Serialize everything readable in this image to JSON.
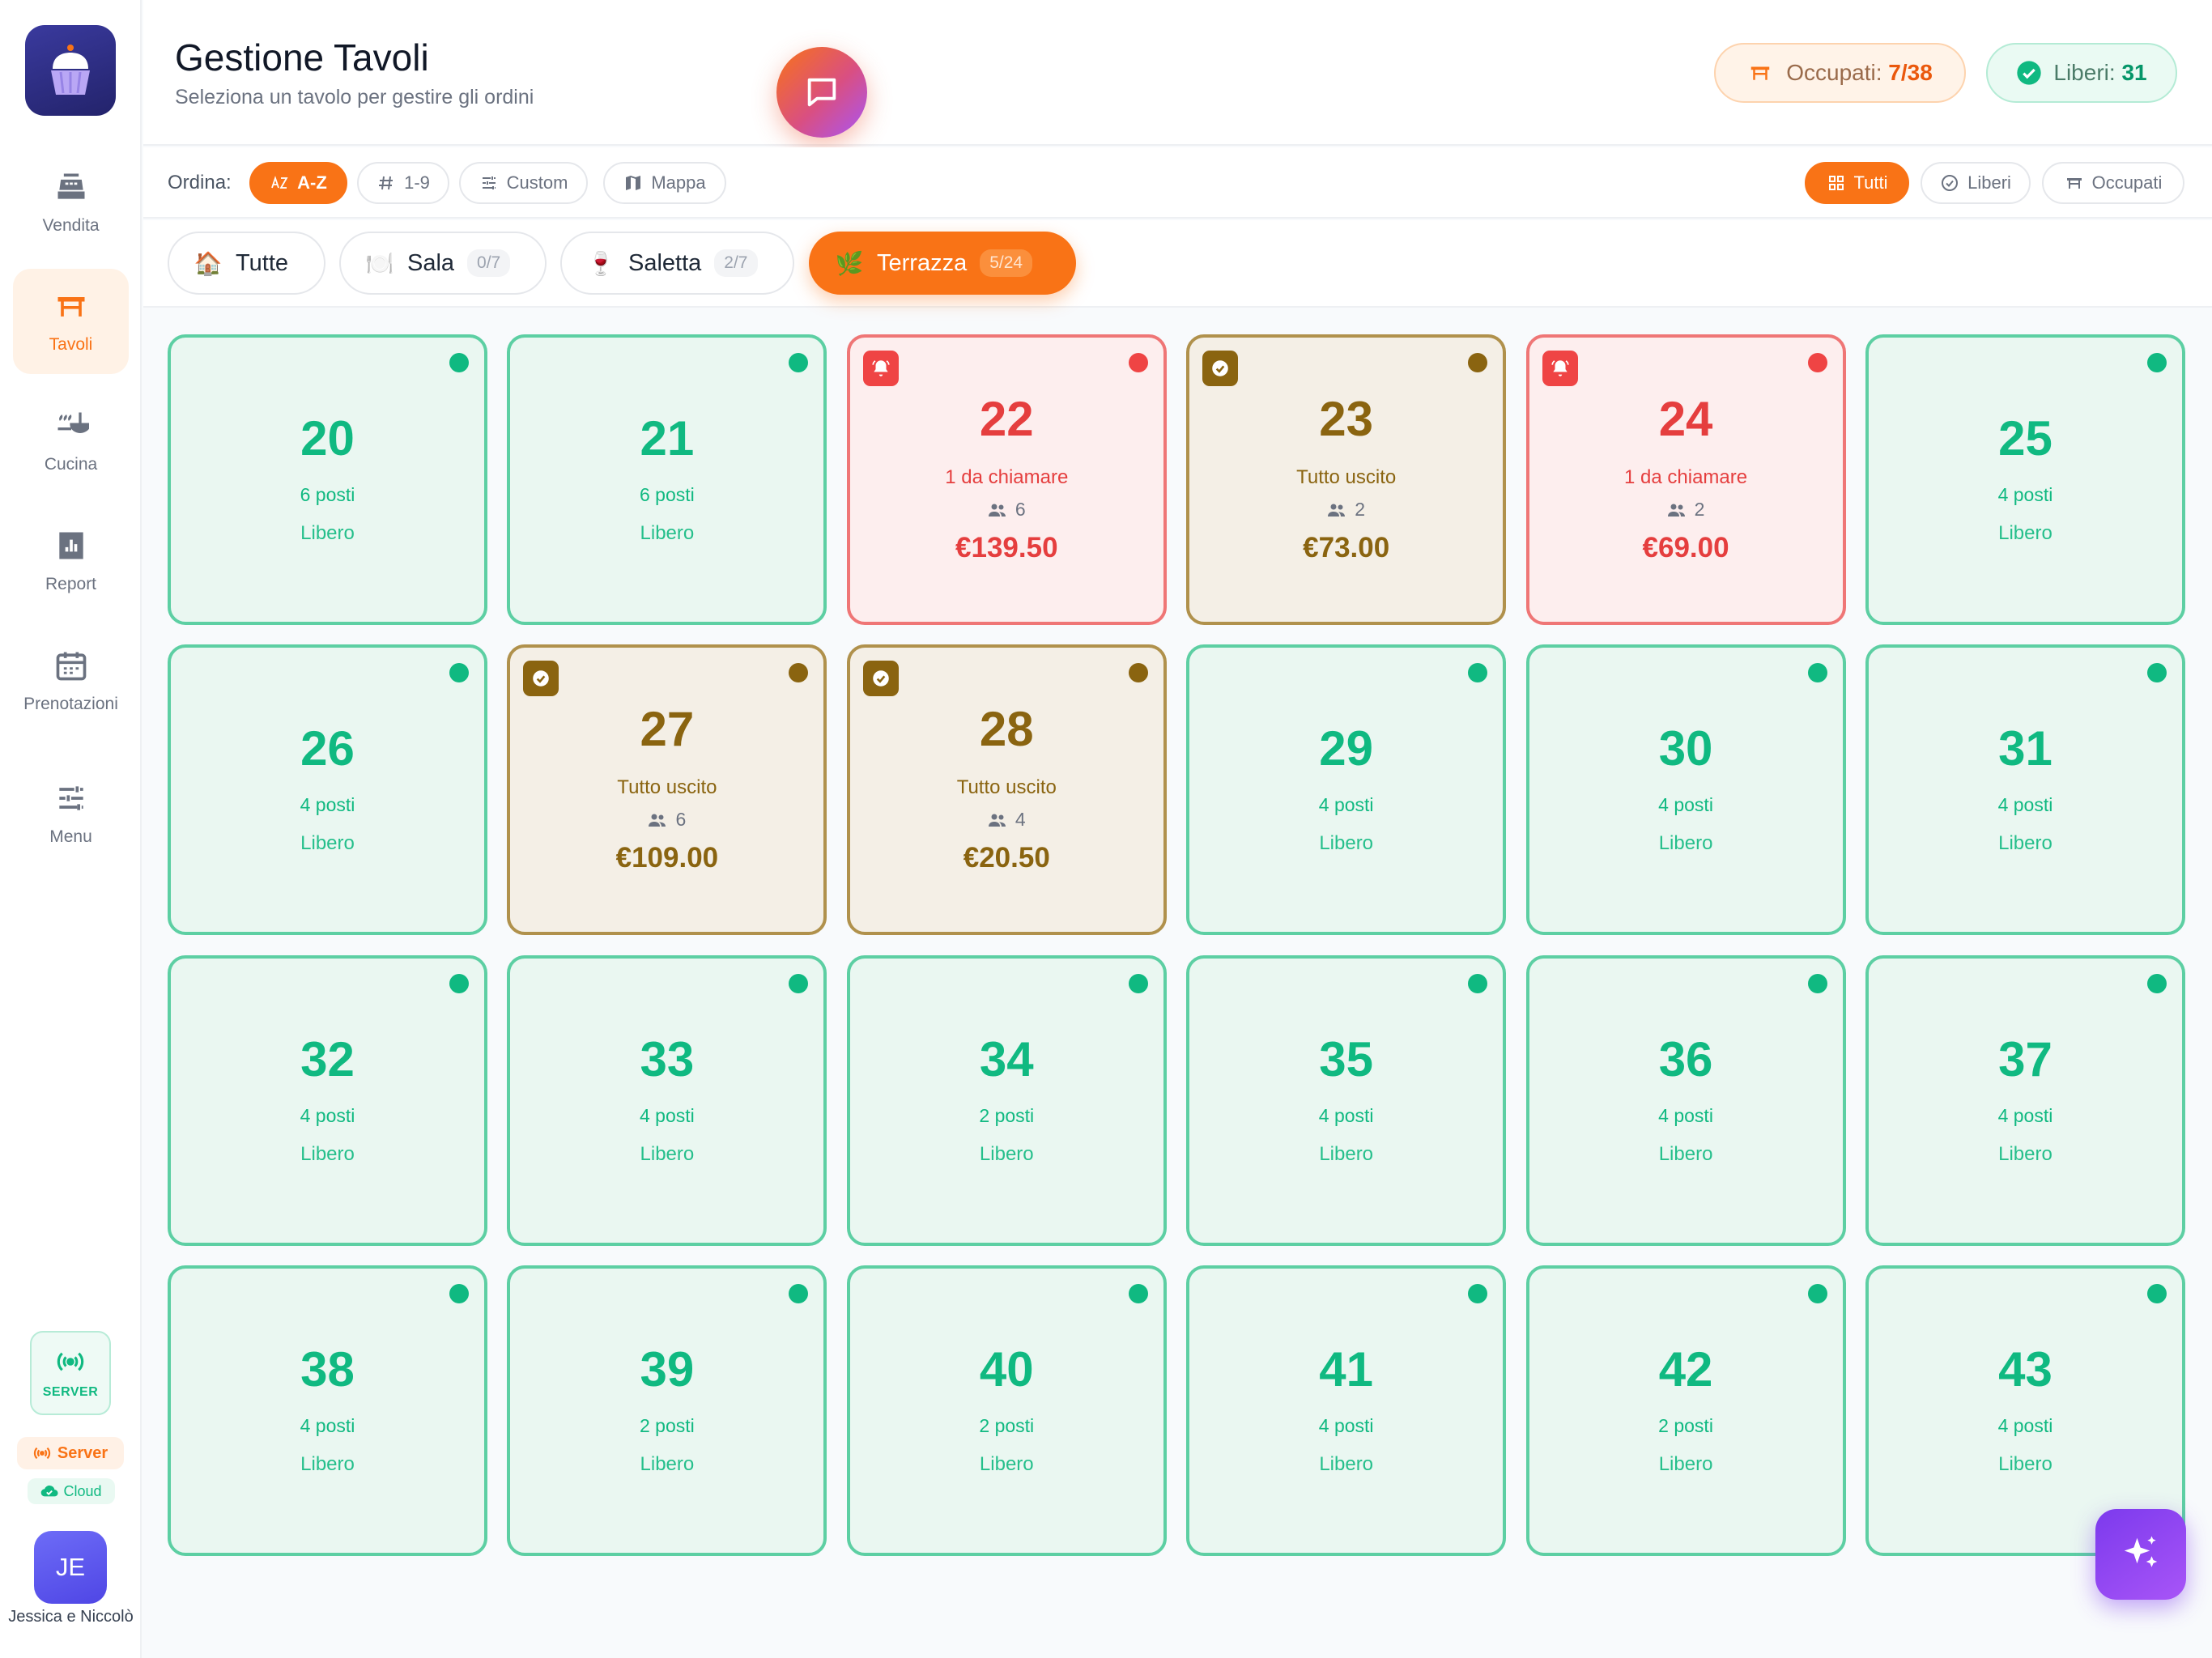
{
  "sidebar": {
    "items": [
      {
        "label": "Vendita",
        "icon": "cash-register-icon",
        "active": false
      },
      {
        "label": "Tavoli",
        "icon": "table-icon",
        "active": true
      },
      {
        "label": "Cucina",
        "icon": "ladle-icon",
        "active": false
      },
      {
        "label": "Report",
        "icon": "chart-icon",
        "active": false
      },
      {
        "label": "Prenotazioni",
        "icon": "calendar-icon",
        "active": false
      },
      {
        "label": "Menu",
        "icon": "sliders-icon",
        "active": false
      }
    ],
    "server_badge": "SERVER",
    "server_pill": "Server",
    "cloud_pill": "Cloud",
    "user_initials": "JE",
    "user_name": "Jessica e Niccolò"
  },
  "header": {
    "title": "Gestione Tavoli",
    "subtitle": "Seleziona un tavolo per gestire gli ordini",
    "occupied_label": "Occupati:",
    "occupied_value": "7/38",
    "free_label": "Liberi:",
    "free_value": "31"
  },
  "sort": {
    "label": "Ordina:",
    "options": [
      "A-Z",
      "1-9",
      "Custom",
      "Mappa"
    ],
    "active": "A-Z"
  },
  "filters": {
    "options": [
      "Tutti",
      "Liberi",
      "Occupati"
    ],
    "active": "Tutti"
  },
  "rooms": [
    {
      "emoji": "🏠",
      "name": "Tutte",
      "count": ""
    },
    {
      "emoji": "🍽️",
      "name": "Sala",
      "count": "0/7"
    },
    {
      "emoji": "🍷",
      "name": "Saletta",
      "count": "2/7"
    },
    {
      "emoji": "🌿",
      "name": "Terrazza",
      "count": "5/24"
    }
  ],
  "active_room": "Terrazza",
  "colors": {
    "accent": "#f97316",
    "free": "#10b981",
    "call": "#ef4444",
    "served": "#8a6410"
  },
  "tables": [
    {
      "number": "20",
      "status": "free",
      "seats": "6 posti",
      "state": "Libero"
    },
    {
      "number": "21",
      "status": "free",
      "seats": "6 posti",
      "state": "Libero"
    },
    {
      "number": "22",
      "status": "call",
      "info": "1 da chiamare",
      "guests": "6",
      "total": "€139.50"
    },
    {
      "number": "23",
      "status": "out",
      "info": "Tutto uscito",
      "guests": "2",
      "total": "€73.00"
    },
    {
      "number": "24",
      "status": "call",
      "info": "1 da chiamare",
      "guests": "2",
      "total": "€69.00"
    },
    {
      "number": "25",
      "status": "free",
      "seats": "4 posti",
      "state": "Libero"
    },
    {
      "number": "26",
      "status": "free",
      "seats": "4 posti",
      "state": "Libero"
    },
    {
      "number": "27",
      "status": "out",
      "info": "Tutto uscito",
      "guests": "6",
      "total": "€109.00"
    },
    {
      "number": "28",
      "status": "out",
      "info": "Tutto uscito",
      "guests": "4",
      "total": "€20.50"
    },
    {
      "number": "29",
      "status": "free",
      "seats": "4 posti",
      "state": "Libero"
    },
    {
      "number": "30",
      "status": "free",
      "seats": "4 posti",
      "state": "Libero"
    },
    {
      "number": "31",
      "status": "free",
      "seats": "4 posti",
      "state": "Libero"
    },
    {
      "number": "32",
      "status": "free",
      "seats": "4 posti",
      "state": "Libero"
    },
    {
      "number": "33",
      "status": "free",
      "seats": "4 posti",
      "state": "Libero"
    },
    {
      "number": "34",
      "status": "free",
      "seats": "2 posti",
      "state": "Libero"
    },
    {
      "number": "35",
      "status": "free",
      "seats": "4 posti",
      "state": "Libero"
    },
    {
      "number": "36",
      "status": "free",
      "seats": "4 posti",
      "state": "Libero"
    },
    {
      "number": "37",
      "status": "free",
      "seats": "4 posti",
      "state": "Libero"
    },
    {
      "number": "38",
      "status": "free",
      "seats": "4 posti",
      "state": "Libero"
    },
    {
      "number": "39",
      "status": "free",
      "seats": "2 posti",
      "state": "Libero"
    },
    {
      "number": "40",
      "status": "free",
      "seats": "2 posti",
      "state": "Libero"
    },
    {
      "number": "41",
      "status": "free",
      "seats": "4 posti",
      "state": "Libero"
    },
    {
      "number": "42",
      "status": "free",
      "seats": "2 posti",
      "state": "Libero"
    },
    {
      "number": "43",
      "status": "free",
      "seats": "4 posti",
      "state": "Libero"
    }
  ]
}
